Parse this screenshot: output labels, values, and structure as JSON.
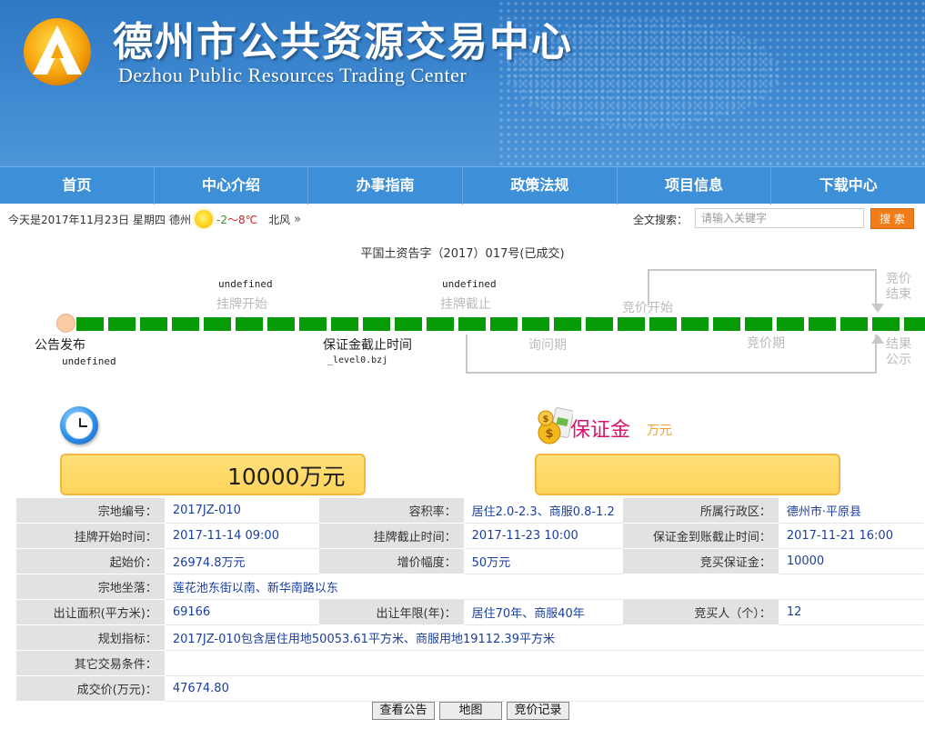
{
  "header": {
    "title_cn": "德州市公共资源交易中心",
    "title_en": "Dezhou Public Resources Trading Center"
  },
  "nav": [
    "首页",
    "中心介绍",
    "办事指南",
    "政策法规",
    "项目信息",
    "下载中心"
  ],
  "infobar": {
    "date": "今天是2017年11月23日 星期四",
    "city": "德州",
    "temp_low": "-2",
    "temp_sep": "～",
    "temp_high": "8℃",
    "wind": "北风",
    "wind_arrow": "»",
    "search_label": "全文搜索：",
    "search_placeholder": "请输入关键字",
    "search_button": "搜 索"
  },
  "doc_title": "平国土资告字（2017）017号(已成交)",
  "timeline": {
    "listing_start_date": "undefined",
    "listing_start": "挂牌开始",
    "listing_end_date": "undefined",
    "listing_end": "挂牌截止",
    "bid_start": "竞价开始",
    "bid_end": "竞价\n结束",
    "announce": "公告发布",
    "announce_date": "undefined",
    "deposit_deadline": "保证金截止时间",
    "deposit_value": "_level0.bzj",
    "inquiry_period": "询问期",
    "bidding_period": "竞价期",
    "result_publish": "结果\n公示"
  },
  "price": {
    "value": "10000万元",
    "bond_label": "保证金",
    "bond_unit": "万元",
    "bond_value": ""
  },
  "table": {
    "r1": [
      "宗地编号：",
      "2017JZ-010",
      "容积率：",
      "居住2.0-2.3、商服0.8-1.2",
      "所属行政区：",
      "德州市·平原县"
    ],
    "r2": [
      "挂牌开始时间：",
      "2017-11-14 09:00",
      "挂牌截止时间：",
      "2017-11-23 10:00",
      "保证金到账截止时间：",
      "2017-11-21 16:00"
    ],
    "r3": [
      "起始价：",
      "26974.8万元",
      "增价幅度：",
      "50万元",
      "竞买保证金：",
      "10000"
    ],
    "r4": [
      "宗地坐落：",
      "莲花池东街以南、新华南路以东"
    ],
    "r5": [
      "出让面积(平方米)：",
      "69166",
      "出让年限(年)：",
      "居住70年、商服40年",
      "竞买人（个）：",
      "12"
    ],
    "r6": [
      "规划指标：",
      "2017JZ-010包含居住用地50053.61平方米、商服用地19112.39平方米"
    ],
    "r7": [
      "其它交易条件：",
      ""
    ],
    "r8": [
      "成交价(万元)：",
      "47674.80"
    ]
  },
  "buttons": {
    "notice": "查看公告",
    "map": "地图",
    "bid_record": "竞价记录"
  },
  "colors": {
    "nav_bg": "#3d8fd8",
    "header_bg": "#2f78c4",
    "timeline_green": "#079b07",
    "search_btn": "#f07d1a",
    "price_box": "#ffd55c",
    "bond_label": "#d9146b",
    "value_text": "#1a3fa0"
  }
}
